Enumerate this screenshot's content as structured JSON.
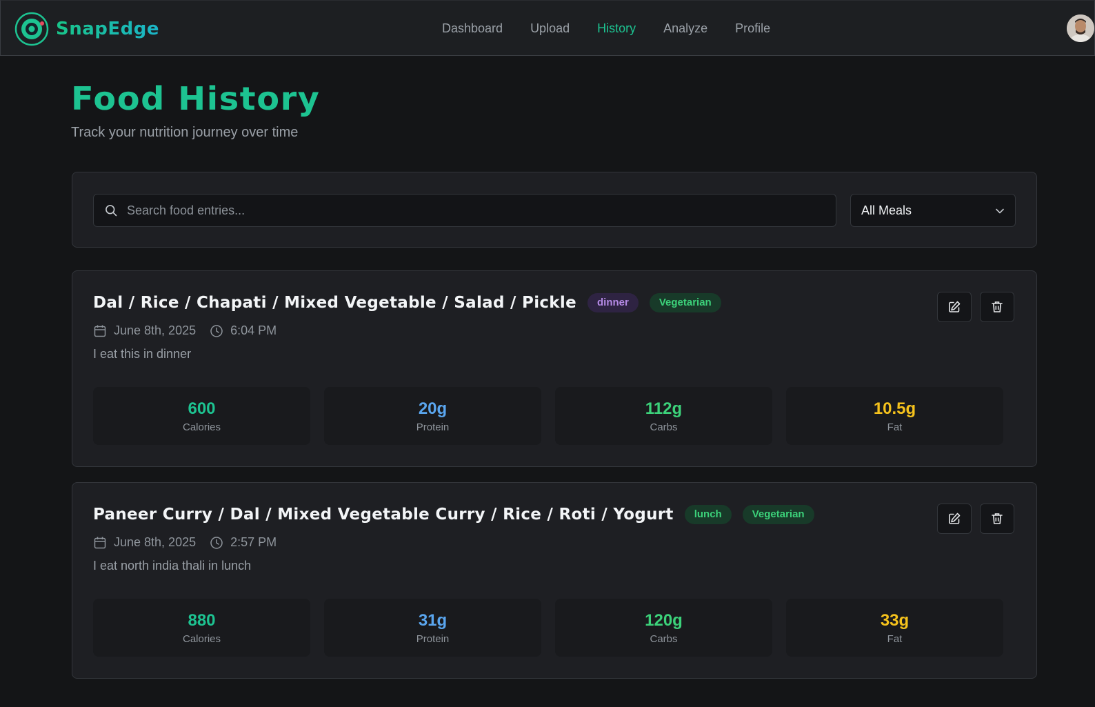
{
  "app": {
    "name": "SnapEdge"
  },
  "nav": {
    "items": [
      {
        "label": "Dashboard",
        "active": false
      },
      {
        "label": "Upload",
        "active": false
      },
      {
        "label": "History",
        "active": true
      },
      {
        "label": "Analyze",
        "active": false
      },
      {
        "label": "Profile",
        "active": false
      }
    ]
  },
  "page": {
    "title": "Food History",
    "subtitle": "Track your nutrition journey over time"
  },
  "filters": {
    "search_placeholder": "Search food entries...",
    "search_value": "",
    "meal_filter": "All Meals"
  },
  "entries": [
    {
      "title": "Dal / Rice / Chapati / Mixed Vegetable / Salad / Pickle",
      "meal_tag": "dinner",
      "diet_tag": "Vegetarian",
      "date": "June 8th, 2025",
      "time": "6:04 PM",
      "note": "I eat this in dinner",
      "stats": [
        {
          "value": "600",
          "label": "Calories"
        },
        {
          "value": "20g",
          "label": "Protein"
        },
        {
          "value": "112g",
          "label": "Carbs"
        },
        {
          "value": "10.5g",
          "label": "Fat"
        }
      ]
    },
    {
      "title": "Paneer Curry / Dal / Mixed Vegetable Curry / Rice / Roti / Yogurt",
      "meal_tag": "lunch",
      "diet_tag": "Vegetarian",
      "date": "June 8th, 2025",
      "time": "2:57 PM",
      "note": "I eat north india thali in lunch",
      "stats": [
        {
          "value": "880",
          "label": "Calories"
        },
        {
          "value": "31g",
          "label": "Protein"
        },
        {
          "value": "120g",
          "label": "Carbs"
        },
        {
          "value": "33g",
          "label": "Fat"
        }
      ]
    }
  ],
  "colors": {
    "accent": "#1dc391",
    "calories": "#1dc391",
    "protein": "#5aa6ef",
    "carbs": "#3cd27a",
    "fat": "#f5c21c",
    "dinner_badge": "#b58ae6",
    "lunch_badge": "#3cd27a"
  },
  "icons": {
    "logo": "camera-lens-icon",
    "search": "search-icon",
    "dropdown": "chevron-down-icon",
    "date": "calendar-icon",
    "time": "clock-icon",
    "edit": "edit-icon",
    "delete": "trash-icon"
  }
}
